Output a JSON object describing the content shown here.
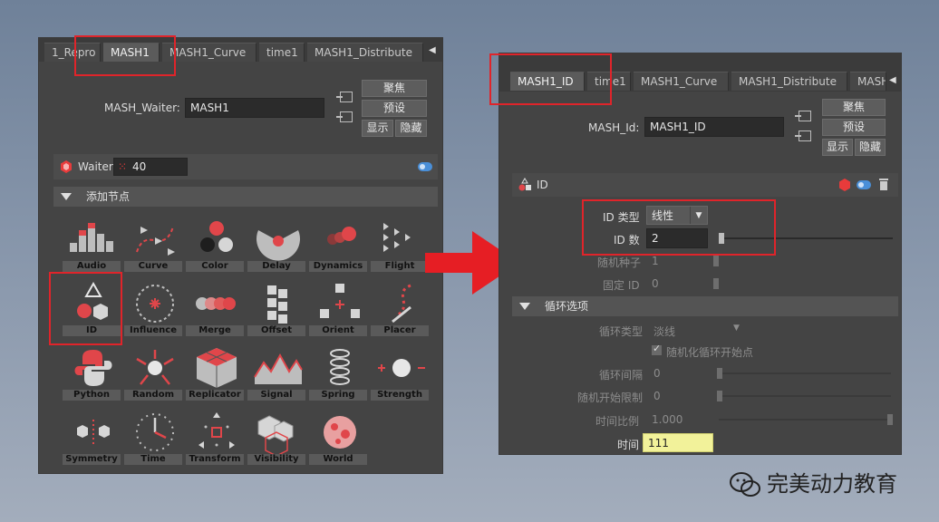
{
  "left": {
    "tabs": [
      "1_Repro",
      "MASH1",
      "MASH1_Curve",
      "time1",
      "MASH1_Distribute"
    ],
    "active_tab": "MASH1",
    "node_field_label": "MASH_Waiter:",
    "node_field_value": "MASH1",
    "buttons": {
      "focus": "聚焦",
      "preset": "预设",
      "show": "显示",
      "hide": "隐藏"
    },
    "waiter_label": "Waiter",
    "waiter_value": "40",
    "section_title": "添加节点",
    "nodes": [
      "Audio",
      "Curve",
      "Color",
      "Delay",
      "Dynamics",
      "Flight",
      "ID",
      "Influence",
      "Merge",
      "Offset",
      "Orient",
      "Placer",
      "Python",
      "Random",
      "Replicator",
      "Signal",
      "Spring",
      "Strength",
      "Symmetry",
      "Time",
      "Transform",
      "Visibility",
      "World"
    ]
  },
  "right": {
    "tabs": [
      "MASH1_ID",
      "time1",
      "MASH1_Curve",
      "MASH1_Distribute",
      "MASH"
    ],
    "active_tab": "MASH1_ID",
    "node_field_label": "MASH_Id:",
    "node_field_value": "MASH1_ID",
    "buttons": {
      "focus": "聚焦",
      "preset": "预设",
      "show": "显示",
      "hide": "隐藏"
    },
    "id_section": "ID",
    "id_type_label": "ID 类型",
    "id_type_value": "线性",
    "id_count_label": "ID 数",
    "id_count_value": "2",
    "random_seed_label": "随机种子",
    "random_seed_value": "1",
    "fixed_id_label": "固定 ID",
    "fixed_id_value": "0",
    "loop_section": "循环选项",
    "loop_type_label": "循环类型",
    "loop_type_value": "淡线",
    "randomize_loop_label": "随机化循环开始点",
    "loop_interval_label": "循环间隔",
    "loop_interval_value": "0",
    "random_start_limit_label": "随机开始限制",
    "random_start_limit_value": "0",
    "time_scale_label": "时间比例",
    "time_scale_value": "1.000",
    "time_label": "时间",
    "time_value": "111"
  },
  "watermark": "完美动力教育",
  "colors": {
    "highlight_red": "#e0242a",
    "time_field": "#f2f29a",
    "panel_bg": "#444444"
  }
}
